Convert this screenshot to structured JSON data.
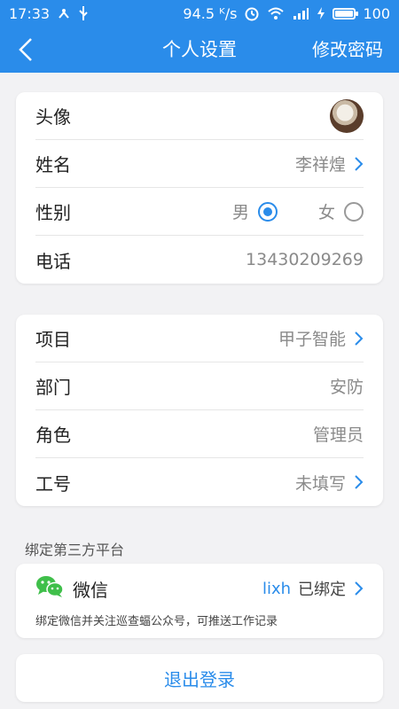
{
  "status_bar": {
    "time": "17:33",
    "speed": "94.5 ᴷ/s",
    "battery": "100",
    "battery_level": 1.0
  },
  "nav": {
    "title": "个人设置",
    "action": "修改密码"
  },
  "profile": {
    "avatar_label": "头像",
    "name_label": "姓名",
    "name_value": "李祥煌",
    "gender_label": "性别",
    "gender_male": "男",
    "gender_female": "女",
    "gender_selected": "男",
    "phone_label": "电话",
    "phone_value": "13430209269"
  },
  "org": {
    "project_label": "项目",
    "project_value": "甲子智能",
    "dept_label": "部门",
    "dept_value": "安防",
    "role_label": "角色",
    "role_value": "管理员",
    "id_label": "工号",
    "id_value": "未填写"
  },
  "binding": {
    "section_title": "绑定第三方平台",
    "platform_name": "微信",
    "account": "lixh",
    "status": "已绑定",
    "description": "绑定微信并关注巡查蝠公众号，可推送工作记录"
  },
  "logout_label": "退出登录",
  "colors": {
    "primary": "#2a8cea",
    "wechat": "#3fbf4a",
    "background": "#f2f2f4"
  }
}
